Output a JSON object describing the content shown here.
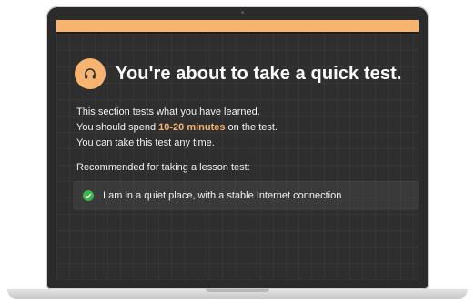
{
  "header": {
    "title": "You're about to take a quick test.",
    "icon": "headphones-icon"
  },
  "body": {
    "line1": "This section tests what you have learned.",
    "line2_pre": "You should spend ",
    "line2_highlight": "10-20 minutes",
    "line2_post": " on the test.",
    "line3": "You can take this test any time."
  },
  "recommended_label": "Recommended for taking a lesson test:",
  "requirements": [
    {
      "text": "I am in a quiet place, with a stable Internet connection",
      "icon": "check-circle-icon",
      "checked": true
    }
  ],
  "colors": {
    "accent": "#f6b46e",
    "check": "#39b54a",
    "screen_bg": "#2e2e2e"
  }
}
